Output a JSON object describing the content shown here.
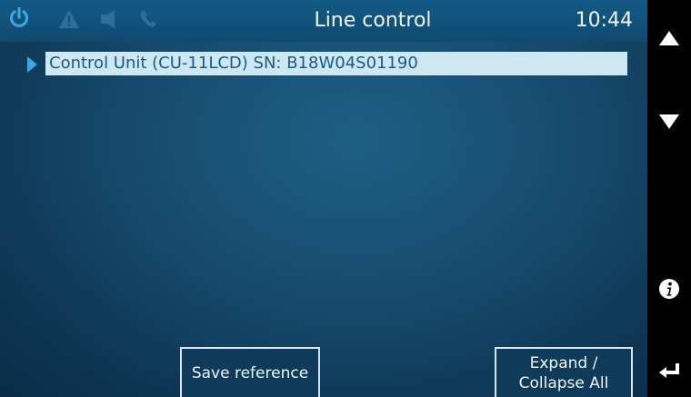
{
  "header": {
    "title": "Line control",
    "time": "10:44",
    "status_icons": [
      "power-icon",
      "warning-icon",
      "speaker-icon",
      "phone-icon"
    ]
  },
  "tree": {
    "items": [
      {
        "label": "Control Unit (CU-11LCD)  SN: B18W04S01190",
        "expanded": false,
        "selected": true
      }
    ]
  },
  "buttons": {
    "save_reference": "Save reference",
    "expand_line1": "Expand /",
    "expand_line2": "Collapse All"
  },
  "sidebar": {
    "icons": [
      "scroll-up-icon",
      "scroll-down-icon",
      "info-icon",
      "back-icon"
    ]
  },
  "colors": {
    "accent": "#3fa4e6",
    "selection_bg": "#cde7f3",
    "selection_text": "#1d5a82",
    "background": "#164a6d"
  }
}
